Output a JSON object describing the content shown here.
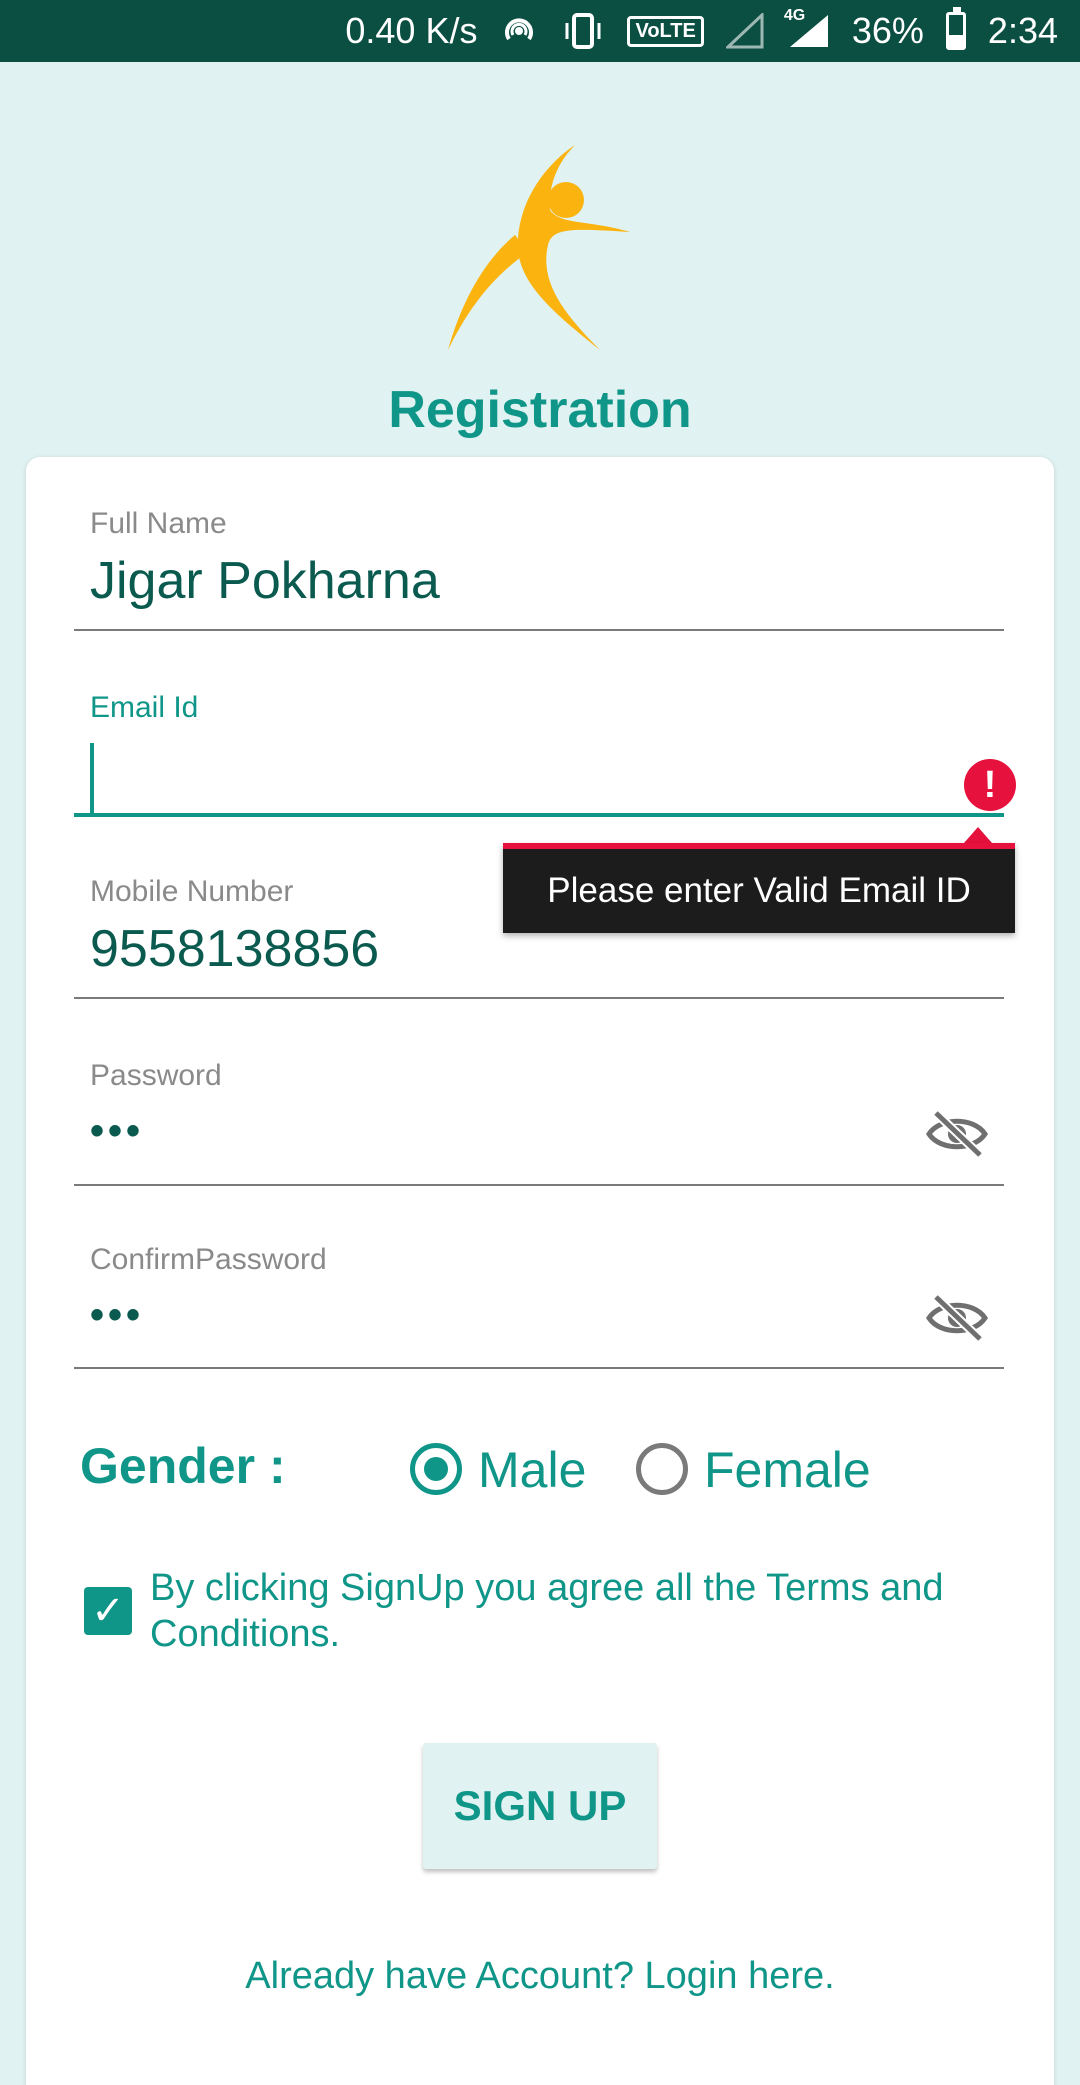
{
  "status_bar": {
    "speed": "0.40 K/s",
    "volte": "VoLTE",
    "network": "4G",
    "battery": "36%",
    "time": "2:34"
  },
  "header": {
    "title": "Registration",
    "logo_icon": "running-person-logo",
    "accent_color": "#0f9688"
  },
  "form": {
    "full_name": {
      "label": "Full Name",
      "value": "Jigar Pokharna"
    },
    "email": {
      "label": "Email Id",
      "value": "",
      "error": "Please enter Valid Email ID"
    },
    "mobile": {
      "label": "Mobile Number",
      "value": "9558138856"
    },
    "password": {
      "label": "Password",
      "value": "•••"
    },
    "confirm_password": {
      "label": "ConfirmPassword",
      "value": "•••"
    },
    "gender": {
      "label": "Gender :",
      "options": [
        "Male",
        "Female"
      ],
      "selected": "Male"
    },
    "terms": {
      "text": "By clicking SignUp you agree all the Terms and Conditions.",
      "checked": true
    },
    "signup_label": "SIGN UP",
    "login_link": "Already have Account? Login here."
  }
}
